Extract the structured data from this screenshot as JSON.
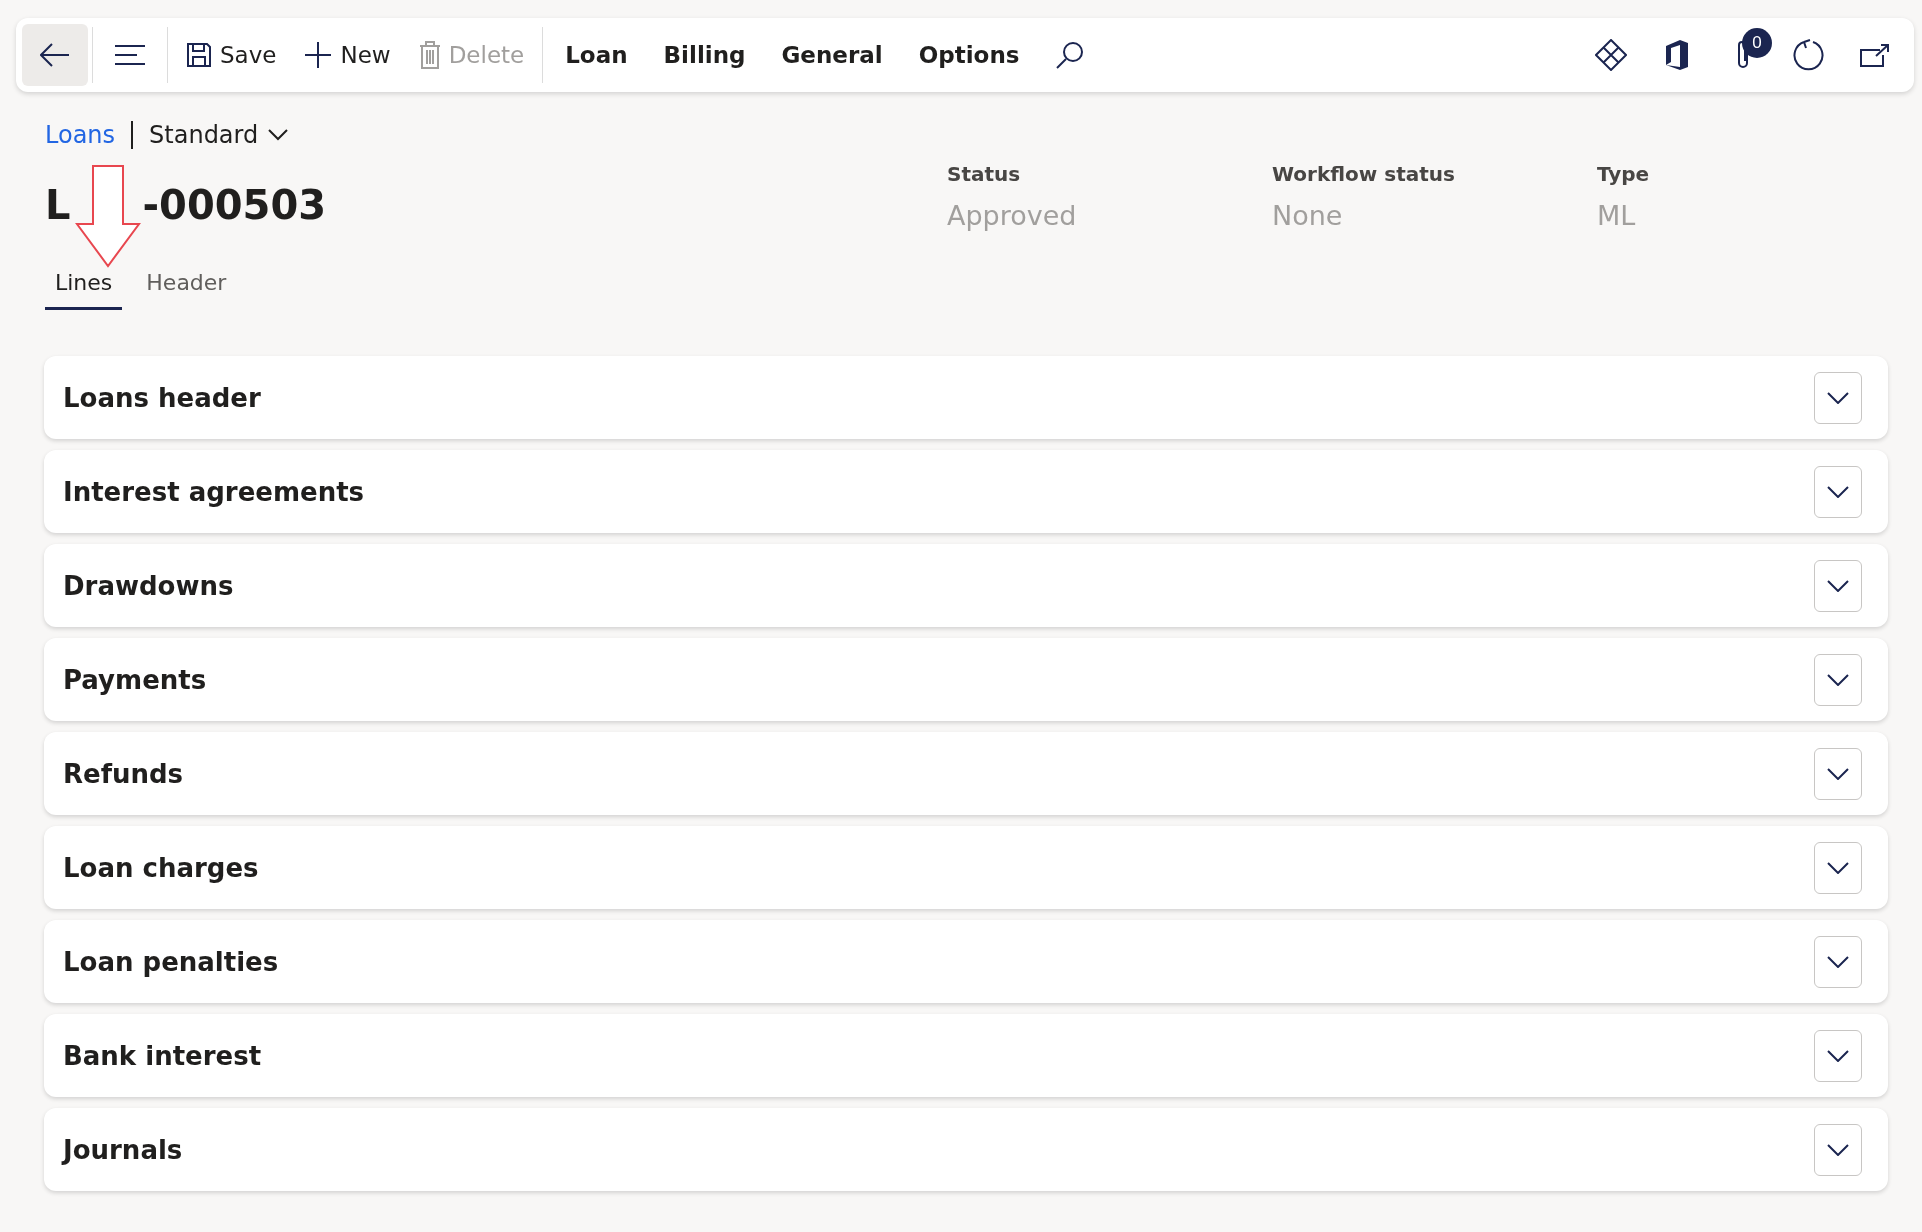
{
  "toolbar": {
    "actions": [
      {
        "kind": "save",
        "label": "Save",
        "disabled": false
      },
      {
        "kind": "new",
        "label": "New",
        "disabled": false
      },
      {
        "kind": "delete",
        "label": "Delete",
        "disabled": true
      }
    ],
    "menus": [
      "Loan",
      "Billing",
      "General",
      "Options"
    ],
    "attachments_count": "0"
  },
  "breadcrumb": {
    "link": "Loans",
    "view": "Standard"
  },
  "record": {
    "title_start": "L",
    "title_end": "-000503"
  },
  "fields": [
    {
      "label": "Status",
      "value": "Approved"
    },
    {
      "label": "Workflow status",
      "value": "None"
    },
    {
      "label": "Type",
      "value": "ML"
    }
  ],
  "tabs": [
    {
      "label": "Lines",
      "selected": true
    },
    {
      "label": "Header",
      "selected": false
    }
  ],
  "sections": [
    {
      "title": "Loans header",
      "expanded": false
    },
    {
      "title": "Interest agreements",
      "expanded": false
    },
    {
      "title": "Drawdowns",
      "expanded": false
    },
    {
      "title": "Payments",
      "expanded": false
    },
    {
      "title": "Refunds",
      "expanded": false
    },
    {
      "title": "Loan charges",
      "expanded": false
    },
    {
      "title": "Loan penalties",
      "expanded": false
    },
    {
      "title": "Bank interest",
      "expanded": false
    },
    {
      "title": "Journals",
      "expanded": false
    }
  ]
}
